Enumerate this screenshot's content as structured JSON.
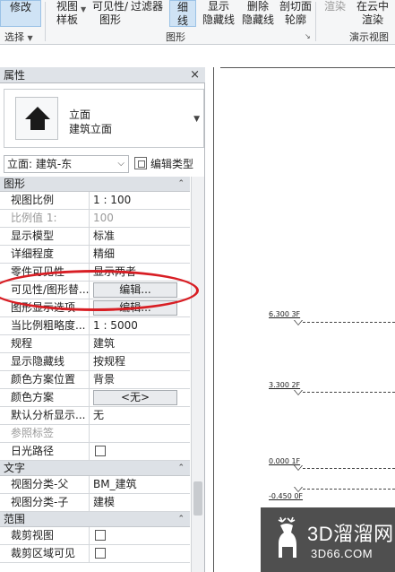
{
  "ribbon": {
    "modify": "修改",
    "select_group": "选择",
    "view_template": [
      "视图",
      "样板"
    ],
    "vis_filter": [
      "可见性/",
      "图形"
    ],
    "filter": "过滤器",
    "thin_lines": [
      "细",
      "线"
    ],
    "show_hidden": [
      "显示",
      "隐藏线"
    ],
    "remove_hidden": [
      "删除",
      "隐藏线"
    ],
    "cut_profile": [
      "剖切面",
      "轮廓"
    ],
    "graphics_group": "图形",
    "render": "渲染",
    "render_cloud": [
      "在云中",
      "渲染"
    ],
    "presentation_group": "演示视图"
  },
  "properties": {
    "title": "属性",
    "close": "×",
    "type_line1": "立面",
    "type_line2": "建筑立面",
    "view_selector": "立面: 建筑-东",
    "edit_type": "编辑类型",
    "sections": [
      {
        "name": "图形",
        "rows": [
          {
            "k": "视图比例",
            "v": "1 : 100"
          },
          {
            "k": "比例值 1:",
            "v": "100",
            "gray": true
          },
          {
            "k": "显示模型",
            "v": "标准"
          },
          {
            "k": "详细程度",
            "v": "精细"
          },
          {
            "k": "零件可见性",
            "v": "显示两者"
          },
          {
            "k": "可见性/图形替...",
            "v": "编辑...",
            "button": true
          },
          {
            "k": "图形显示选项",
            "v": "编辑...",
            "button": true
          },
          {
            "k": "当比例粗略度...",
            "v": "1 : 5000"
          },
          {
            "k": "规程",
            "v": "建筑"
          },
          {
            "k": "显示隐藏线",
            "v": "按规程"
          },
          {
            "k": "颜色方案位置",
            "v": "背景"
          },
          {
            "k": "颜色方案",
            "v": "<无>",
            "button": true
          },
          {
            "k": "默认分析显示...",
            "v": "无"
          },
          {
            "k": "参照标签",
            "v": "",
            "gray": true
          },
          {
            "k": "日光路径",
            "v": "",
            "checkbox": true
          }
        ]
      },
      {
        "name": "文字",
        "rows": [
          {
            "k": "视图分类-父",
            "v": "BM_建筑"
          },
          {
            "k": "视图分类-子",
            "v": "建模"
          }
        ]
      },
      {
        "name": "范围",
        "rows": [
          {
            "k": "裁剪视图",
            "v": "",
            "checkbox": true
          },
          {
            "k": "裁剪区域可见",
            "v": "",
            "checkbox": true
          }
        ]
      }
    ]
  },
  "drawing": {
    "levels": [
      "6.300 3F",
      "3.300 2F",
      "0.000 1F",
      "-0.450 0F"
    ]
  },
  "watermark": {
    "title": "3D溜溜网",
    "url": "3D66.COM"
  }
}
